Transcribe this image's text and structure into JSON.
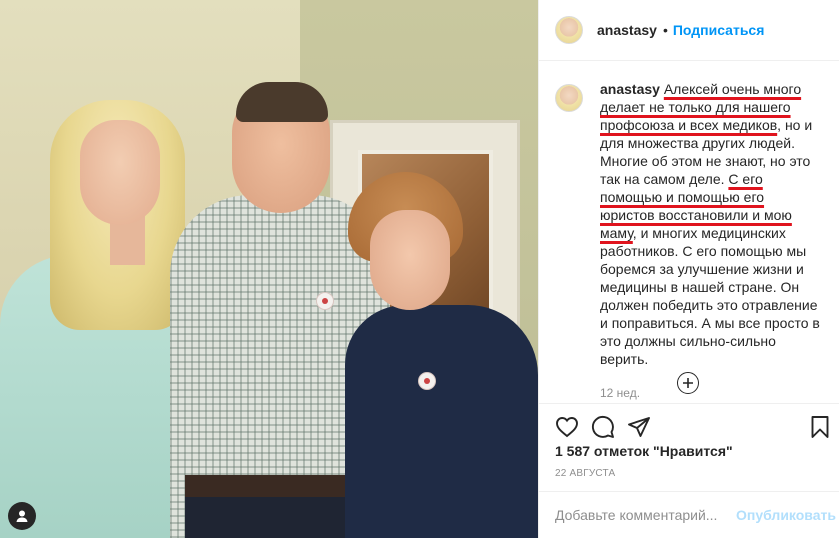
{
  "post": {
    "username": "anastasy",
    "follow_label": "Подписаться",
    "dot": "•"
  },
  "caption": {
    "username": "anastasy",
    "parts": [
      {
        "text": "Алексей очень много делает не только для нашего профсоюза и всех медиков",
        "underlined": true
      },
      {
        "text": ", но и для множества других людей. Многие об этом не знают, но это так на самом деле. ",
        "underlined": false
      },
      {
        "text": "С его помощью и помощью его юристов восстановили и мою маму",
        "underlined": true
      },
      {
        "text": ", и многих медицинских работников. С его помощью мы боремся за улучшение жизни и медицины в нашей стране. Он должен победить это отравление и поправиться. А мы все просто в это должны сильно-сильно верить.",
        "underlined": false
      }
    ],
    "time": "12 нед.",
    "underline_color": "#e0141e"
  },
  "stats": {
    "likes": "1 587 отметок \"Нравится\"",
    "date": "22 августа"
  },
  "comment_box": {
    "placeholder": "Добавьте комментарий...",
    "post_label": "Опубликовать"
  },
  "icons": {
    "like": "heart-icon",
    "comment": "comment-icon",
    "share": "paper-plane-icon",
    "save": "bookmark-icon",
    "load_more": "plus-circle-icon",
    "tagged": "user-tag-icon"
  },
  "colors": {
    "accent": "#0095f6",
    "post_disabled": "#b2dffc",
    "meta": "#8e8e8e"
  }
}
